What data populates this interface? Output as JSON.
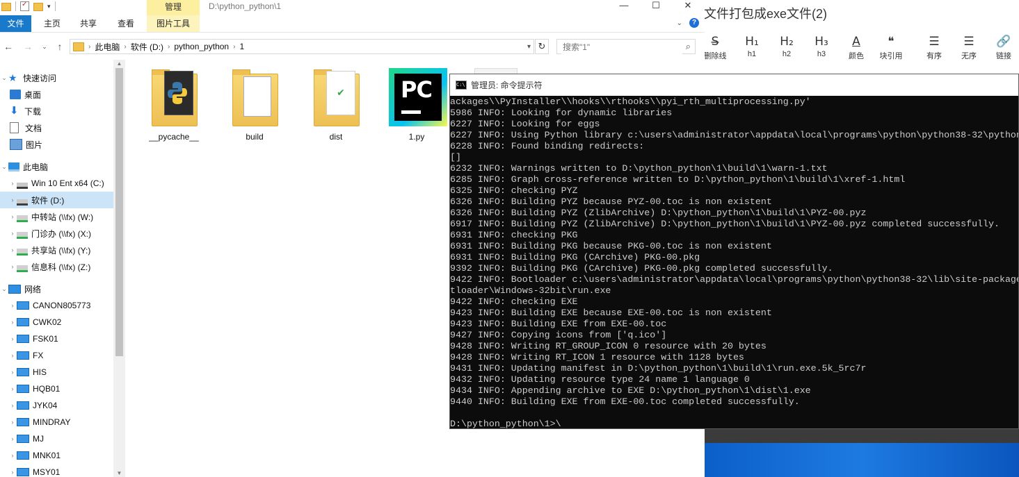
{
  "explorer": {
    "manage_tab": "管理",
    "window_path": "D:\\python_python\\1",
    "ribbon_tabs": [
      "文件",
      "主页",
      "共享",
      "查看",
      "图片工具"
    ],
    "help_label": "?",
    "controls": {
      "minimize": "—",
      "maximize": "☐",
      "close": "✕"
    },
    "address": {
      "crumbs": [
        "此电脑",
        "软件 (D:)",
        "python_python",
        "1"
      ]
    },
    "search_placeholder": "搜索\"1\"",
    "sidebar": {
      "quick_access": "快速访问",
      "quick_items": [
        "桌面",
        "下载",
        "文档",
        "图片"
      ],
      "this_pc": "此电脑",
      "drives": [
        "Win 10 Ent x64 (C:)",
        "软件 (D:)",
        "中转站 (\\\\fx) (W:)",
        "门诊办 (\\\\fx) (X:)",
        "共享站 (\\\\fx) (Y:)",
        "信息科 (\\\\fx) (Z:)"
      ],
      "network": "网络",
      "computers": [
        "CANON805773",
        "CWK02",
        "FSK01",
        "FX",
        "HIS",
        "HQB01",
        "JYK04",
        "MINDRAY",
        "MJ",
        "MNK01",
        "MSY01"
      ]
    },
    "files": [
      "__pycache__",
      "build",
      "dist",
      "1.py"
    ]
  },
  "editor": {
    "title": "文件打包成exe文件(2)",
    "tools": [
      {
        "glyph": "S̶",
        "label": "删除线"
      },
      {
        "glyph": "H₁",
        "label": "h1"
      },
      {
        "glyph": "H₂",
        "label": "h2"
      },
      {
        "glyph": "H₃",
        "label": "h3"
      },
      {
        "glyph": "A",
        "label": "颜色"
      },
      {
        "glyph": "❝",
        "label": "块引用"
      },
      {
        "glyph": "☰",
        "label": "有序"
      },
      {
        "glyph": "☰",
        "label": "无序"
      },
      {
        "glyph": "🔗",
        "label": "链接"
      }
    ]
  },
  "cmd": {
    "title": "管理员: 命令提示符",
    "lines": [
      "ackages\\\\PyInstaller\\\\hooks\\\\rthooks\\\\pyi_rth_multiprocessing.py'",
      "5986 INFO: Looking for dynamic libraries",
      "6227 INFO: Looking for eggs",
      "6227 INFO: Using Python library c:\\users\\administrator\\appdata\\local\\programs\\python\\python38-32\\python",
      "6228 INFO: Found binding redirects:",
      "[]",
      "6232 INFO: Warnings written to D:\\python_python\\1\\build\\1\\warn-1.txt",
      "6285 INFO: Graph cross-reference written to D:\\python_python\\1\\build\\1\\xref-1.html",
      "6325 INFO: checking PYZ",
      "6326 INFO: Building PYZ because PYZ-00.toc is non existent",
      "6326 INFO: Building PYZ (ZlibArchive) D:\\python_python\\1\\build\\1\\PYZ-00.pyz",
      "6917 INFO: Building PYZ (ZlibArchive) D:\\python_python\\1\\build\\1\\PYZ-00.pyz completed successfully.",
      "6931 INFO: checking PKG",
      "6931 INFO: Building PKG because PKG-00.toc is non existent",
      "6931 INFO: Building PKG (CArchive) PKG-00.pkg",
      "9392 INFO: Building PKG (CArchive) PKG-00.pkg completed successfully.",
      "9422 INFO: Bootloader c:\\users\\administrator\\appdata\\local\\programs\\python\\python38-32\\lib\\site-package",
      "tloader\\Windows-32bit\\run.exe",
      "9422 INFO: checking EXE",
      "9423 INFO: Building EXE because EXE-00.toc is non existent",
      "9423 INFO: Building EXE from EXE-00.toc",
      "9427 INFO: Copying icons from ['q.ico']",
      "9428 INFO: Writing RT_GROUP_ICON 0 resource with 20 bytes",
      "9428 INFO: Writing RT_ICON 1 resource with 1128 bytes",
      "9431 INFO: Updating manifest in D:\\python_python\\1\\build\\1\\run.exe.5k_5rc7r",
      "9432 INFO: Updating resource type 24 name 1 language 0",
      "9434 INFO: Appending archive to EXE D:\\python_python\\1\\dist\\1.exe",
      "9440 INFO: Building EXE from EXE-00.toc completed successfully.",
      "",
      "D:\\python_python\\1>\\"
    ]
  }
}
